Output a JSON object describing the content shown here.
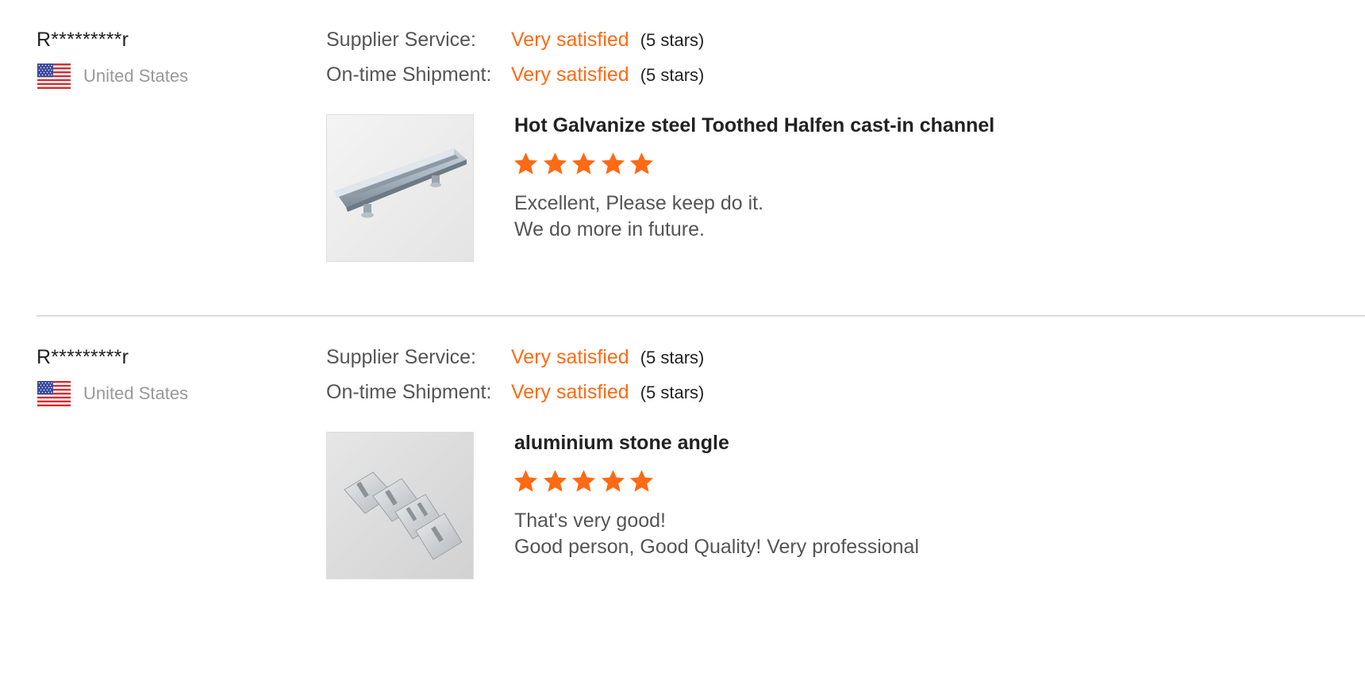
{
  "reviews": [
    {
      "reviewer": "R*********r",
      "country": "United States",
      "flag_icon": "us-flag-icon",
      "ratings": [
        {
          "label": "Supplier Service:",
          "value": "Very satisfied",
          "stars_text": "(5 stars)"
        },
        {
          "label": "On-time Shipment:",
          "value": "Very satisfied",
          "stars_text": "(5 stars)"
        }
      ],
      "product": {
        "title": "Hot Galvanize steel Toothed Halfen cast-in channel",
        "image_icon": "cast-in-channel-photo",
        "star_rating": 5,
        "comment_lines": [
          "Excellent, Please keep do it.",
          "We do more in future."
        ]
      }
    },
    {
      "reviewer": "R*********r",
      "country": "United States",
      "flag_icon": "us-flag-icon",
      "ratings": [
        {
          "label": "Supplier Service:",
          "value": "Very satisfied",
          "stars_text": "(5 stars)"
        },
        {
          "label": "On-time Shipment:",
          "value": "Very satisfied",
          "stars_text": "(5 stars)"
        }
      ],
      "product": {
        "title": "aluminium stone angle",
        "image_icon": "stone-angle-photo",
        "star_rating": 5,
        "comment_lines": [
          "That's very good!",
          "Good person, Good Quality! Very professional"
        ]
      }
    }
  ],
  "colors": {
    "accent": "#ff6a14",
    "star": "#ff6a14",
    "divider": "#dcdcdc",
    "muted": "#999999"
  }
}
